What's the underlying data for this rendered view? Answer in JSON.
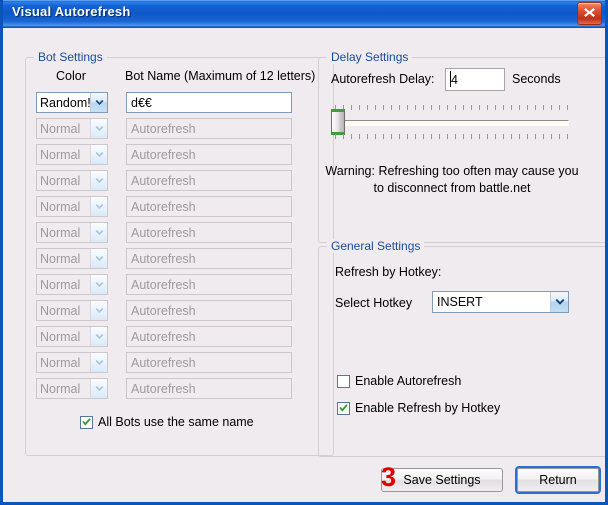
{
  "window": {
    "title": "Visual Autorefresh",
    "close_icon": "close-icon"
  },
  "bot_settings": {
    "legend": "Bot Settings",
    "column_headers": {
      "color": "Color",
      "name": "Bot Name (Maximum of 12 letters)"
    },
    "rows": [
      {
        "color": "Random!",
        "name": "d€€",
        "enabled": true,
        "placeholder": ""
      },
      {
        "color": "Normal",
        "name": "Autorefresh",
        "enabled": false,
        "placeholder": "Autorefresh"
      },
      {
        "color": "Normal",
        "name": "Autorefresh",
        "enabled": false,
        "placeholder": "Autorefresh"
      },
      {
        "color": "Normal",
        "name": "Autorefresh",
        "enabled": false,
        "placeholder": "Autorefresh"
      },
      {
        "color": "Normal",
        "name": "Autorefresh",
        "enabled": false,
        "placeholder": "Autorefresh"
      },
      {
        "color": "Normal",
        "name": "Autorefresh",
        "enabled": false,
        "placeholder": "Autorefresh"
      },
      {
        "color": "Normal",
        "name": "Autorefresh",
        "enabled": false,
        "placeholder": "Autorefresh"
      },
      {
        "color": "Normal",
        "name": "Autorefresh",
        "enabled": false,
        "placeholder": "Autorefresh"
      },
      {
        "color": "Normal",
        "name": "Autorefresh",
        "enabled": false,
        "placeholder": "Autorefresh"
      },
      {
        "color": "Normal",
        "name": "Autorefresh",
        "enabled": false,
        "placeholder": "Autorefresh"
      },
      {
        "color": "Normal",
        "name": "Autorefresh",
        "enabled": false,
        "placeholder": "Autorefresh"
      },
      {
        "color": "Normal",
        "name": "Autorefresh",
        "enabled": false,
        "placeholder": "Autorefresh"
      }
    ],
    "same_name_checkbox": {
      "label": "All Bots use the same name",
      "checked": true
    }
  },
  "delay_settings": {
    "legend": "Delay Settings",
    "delay_label": "Autorefresh Delay:",
    "delay_value": "4",
    "seconds_label": "Seconds",
    "slider": {
      "position_percent": 0,
      "min": 0,
      "max": 100
    },
    "warning_line1": "Warning: Refreshing too often may cause you",
    "warning_line2": "to disconnect from battle.net"
  },
  "general_settings": {
    "legend": "General Settings",
    "refresh_by_hotkey_label": "Refresh by Hotkey:",
    "select_hotkey_label": "Select Hotkey",
    "hotkey_value": "INSERT",
    "enable_autorefresh": {
      "label": "Enable Autorefresh",
      "checked": false
    },
    "enable_refresh_by_hotkey": {
      "label": "Enable Refresh by Hotkey",
      "checked": true
    }
  },
  "footer": {
    "save_label": "Save Settings",
    "return_label": "Return",
    "annotation_marker": "3"
  },
  "colors": {
    "titlebar_blue": "#0e58c8",
    "window_border": "#0b55b8",
    "dialog_bg": "#efebef",
    "legend_text": "#1c4b9c",
    "close_red": "#c0301a",
    "check_green": "#2e9c2e",
    "marker_red": "#e00000",
    "focus_blue": "#2c6fce",
    "slider_green": "#3aa03a"
  }
}
